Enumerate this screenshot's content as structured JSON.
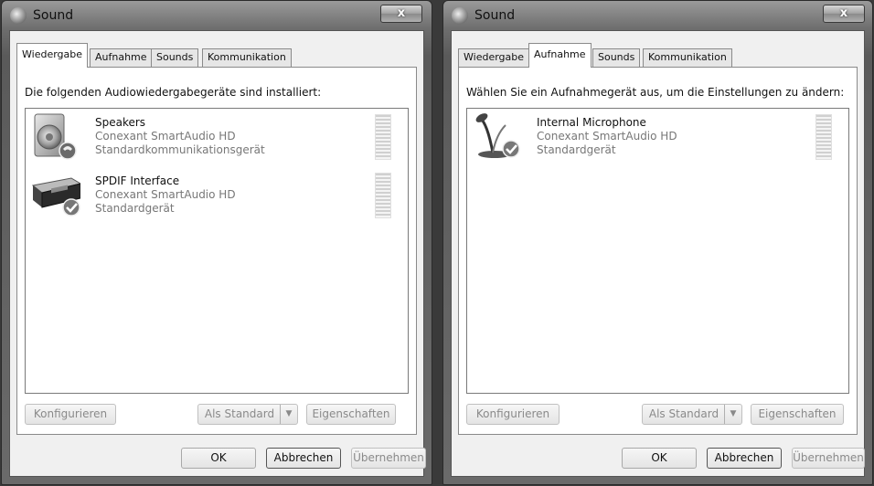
{
  "left": {
    "title": "Sound",
    "close_glyph": "x",
    "tabs": [
      {
        "label": "Wiedergabe",
        "active": true
      },
      {
        "label": "Aufnahme",
        "active": false
      },
      {
        "label": "Sounds",
        "active": false
      },
      {
        "label": "Kommunikation",
        "active": false
      }
    ],
    "instruction": "Die folgenden Audiowiedergabegeräte sind installiert:",
    "devices": [
      {
        "name": "Speakers",
        "driver": "Conexant SmartAudio HD",
        "status": "Standardkommunikationsgerät",
        "icon": "speaker-icon",
        "badge": "phone-badge-icon"
      },
      {
        "name": "SPDIF Interface",
        "driver": "Conexant SmartAudio HD",
        "status": "Standardgerät",
        "icon": "spdif-receiver-icon",
        "badge": "check-badge-icon"
      }
    ],
    "buttons": {
      "configure": "Konfigurieren",
      "set_default": "Als Standard",
      "properties": "Eigenschaften",
      "ok": "OK",
      "cancel": "Abbrechen",
      "apply": "Übernehmen"
    }
  },
  "right": {
    "title": "Sound",
    "close_glyph": "x",
    "tabs": [
      {
        "label": "Wiedergabe",
        "active": false
      },
      {
        "label": "Aufnahme",
        "active": true
      },
      {
        "label": "Sounds",
        "active": false
      },
      {
        "label": "Kommunikation",
        "active": false
      }
    ],
    "instruction": "Wählen Sie ein Aufnahmegerät aus, um die Einstellungen zu ändern:",
    "devices": [
      {
        "name": "Internal Microphone",
        "driver": "Conexant SmartAudio HD",
        "status": "Standardgerät",
        "icon": "microphone-icon",
        "badge": "check-badge-icon"
      }
    ],
    "buttons": {
      "configure": "Konfigurieren",
      "set_default": "Als Standard",
      "properties": "Eigenschaften",
      "ok": "OK",
      "cancel": "Abbrechen",
      "apply": "Übernehmen"
    }
  }
}
